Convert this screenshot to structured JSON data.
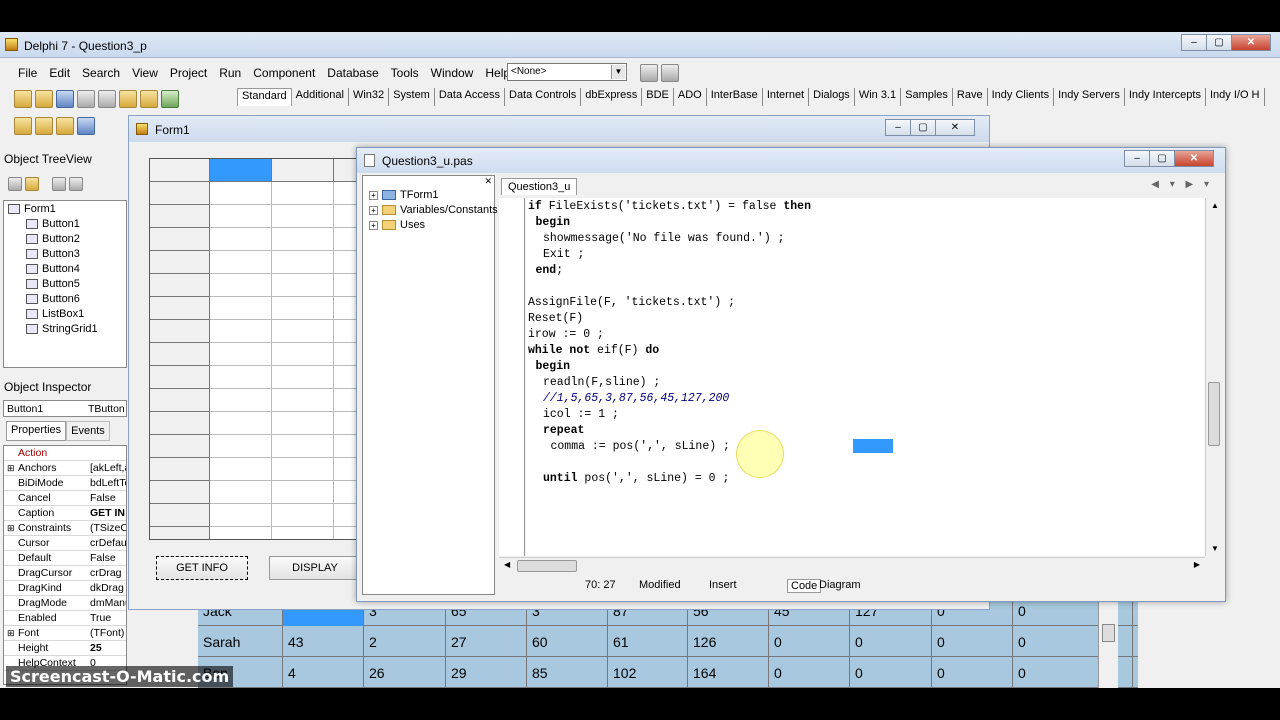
{
  "ide": {
    "title": "Delphi 7 - Question3_p",
    "menu": [
      "File",
      "Edit",
      "Search",
      "View",
      "Project",
      "Run",
      "Component",
      "Database",
      "Tools",
      "Window",
      "Help"
    ],
    "combo_value": "<None>",
    "palette_tabs": [
      "Standard",
      "Additional",
      "Win32",
      "System",
      "Data Access",
      "Data Controls",
      "dbExpress",
      "BDE",
      "ADO",
      "InterBase",
      "Internet",
      "Dialogs",
      "Win 3.1",
      "Samples",
      "Rave",
      "Indy Clients",
      "Indy Servers",
      "Indy Intercepts",
      "Indy I/O H"
    ]
  },
  "treeview": {
    "title": "Object TreeView",
    "root": "Form1",
    "items": [
      "Button1",
      "Button2",
      "Button3",
      "Button4",
      "Button5",
      "Button6",
      "ListBox1",
      "StringGrid1"
    ]
  },
  "inspector": {
    "title": "Object Inspector",
    "object_name": "Button1",
    "object_type": "TButton",
    "tabs": [
      "Properties",
      "Events"
    ],
    "rows": [
      {
        "name": "Action",
        "value": "",
        "plus": ""
      },
      {
        "name": "Anchors",
        "value": "[akLeft,a",
        "plus": "⊞"
      },
      {
        "name": "BiDiMode",
        "value": "bdLeftTo",
        "plus": ""
      },
      {
        "name": "Cancel",
        "value": "False",
        "plus": ""
      },
      {
        "name": "Caption",
        "value": "GET IN",
        "plus": ""
      },
      {
        "name": "Constraints",
        "value": "(TSizeCo",
        "plus": "⊞"
      },
      {
        "name": "Cursor",
        "value": "crDefaul",
        "plus": ""
      },
      {
        "name": "Default",
        "value": "False",
        "plus": ""
      },
      {
        "name": "DragCursor",
        "value": "crDrag",
        "plus": ""
      },
      {
        "name": "DragKind",
        "value": "dkDrag",
        "plus": ""
      },
      {
        "name": "DragMode",
        "value": "dmManu",
        "plus": ""
      },
      {
        "name": "Enabled",
        "value": "True",
        "plus": ""
      },
      {
        "name": "Font",
        "value": "(TFont)",
        "plus": "⊞"
      },
      {
        "name": "Height",
        "value": "25",
        "plus": ""
      },
      {
        "name": "HelpContext",
        "value": "0",
        "plus": ""
      }
    ]
  },
  "form1": {
    "title": "Form1",
    "button_getinfo": "GET INFO",
    "button_display": "DISPLAY"
  },
  "appgrid": {
    "rows": [
      [
        "Jack",
        "",
        "3",
        "65",
        "3",
        "87",
        "56",
        "45",
        "127",
        "0",
        "0"
      ],
      [
        "Sarah",
        "43",
        "2",
        "27",
        "60",
        "61",
        "126",
        "0",
        "0",
        "0",
        "0"
      ],
      [
        "Ben",
        "4",
        "26",
        "29",
        "85",
        "102",
        "164",
        "0",
        "0",
        "0",
        "0"
      ]
    ]
  },
  "editor": {
    "title": "Question3_u.pas",
    "tab": "Question3_u",
    "explorer": [
      "TForm1",
      "Variables/Constants",
      "Uses"
    ],
    "code": [
      {
        "t": "if FileExists('tickets.txt') = false then",
        "indent": 0,
        "kind": "normal"
      },
      {
        "t": "begin",
        "indent": 1,
        "kind": "normal"
      },
      {
        "t": "showmessage('No file was found.') ;",
        "indent": 2,
        "kind": "normal"
      },
      {
        "t": "Exit ;",
        "indent": 2,
        "kind": "normal"
      },
      {
        "t": "end;",
        "indent": 1,
        "kind": "normal"
      },
      {
        "t": "",
        "indent": 0,
        "kind": "normal"
      },
      {
        "t": "AssignFile(F, 'tickets.txt') ;",
        "indent": 0,
        "kind": "normal"
      },
      {
        "t": "Reset(F)",
        "indent": 0,
        "kind": "normal"
      },
      {
        "t": "irow := 0 ;",
        "indent": 0,
        "kind": "normal"
      },
      {
        "t": "while not eif(F) do",
        "indent": 0,
        "kind": "normal"
      },
      {
        "t": "begin",
        "indent": 1,
        "kind": "normal"
      },
      {
        "t": "readln(F,sline) ;",
        "indent": 2,
        "kind": "normal"
      },
      {
        "t": "//1,5,65,3,87,56,45,127,200",
        "indent": 2,
        "kind": "comment"
      },
      {
        "t": "icol := 1 ;",
        "indent": 2,
        "kind": "normal"
      },
      {
        "t": "repeat",
        "indent": 2,
        "kind": "normal"
      },
      {
        "t": "comma := pos(',', sLine) ;",
        "indent": 3,
        "kind": "normal"
      },
      {
        "t": "",
        "indent": 0,
        "kind": "normal"
      },
      {
        "t": "until pos(',', sLine) = 0 ;",
        "indent": 2,
        "kind": "normal"
      }
    ],
    "status": {
      "position": "70: 27",
      "modified": "Modified",
      "mode": "Insert",
      "tabs": [
        "Code",
        "Diagram"
      ]
    }
  },
  "watermark": "Screencast-O-Matic.com"
}
